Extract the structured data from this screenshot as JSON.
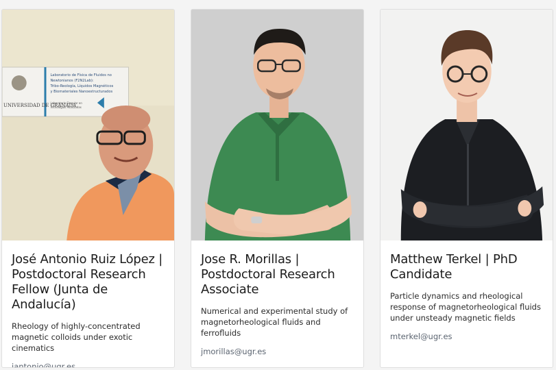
{
  "people": [
    {
      "name": "José Antonio Ruiz López | Postdoctoral Research Fellow (Junta de Andalucía)",
      "description": "Rheology of highly-concentrated magnetic colloids under exotic cinematics",
      "email": "jantonio@ugr.es",
      "sign_lines": [
        "Laboratorio de Física de Fluidos no",
        "Newtonianos (F2N2Lab):",
        "Tribo-Reología, Líquidos Magnéticos",
        "y Biomateriales Nanoestructurados"
      ],
      "sign_small": [
        "Laboratorio Singular en",
        "Tecnologías Avanzadas"
      ],
      "sign_university": "UNIVERSIDAD DE GRANADA"
    },
    {
      "name": "Jose R. Morillas | Postdoctoral Research Associate",
      "description": "Numerical and experimental study of magnetorheological fluids and ferrofluids",
      "email": "jmorillas@ugr.es"
    },
    {
      "name": "Matthew Terkel | PhD Candidate",
      "description": "Particle dynamics and rheological response of magnetorheological fluids under unsteady magnetic fields",
      "email": "mterkel@ugr.es"
    }
  ]
}
